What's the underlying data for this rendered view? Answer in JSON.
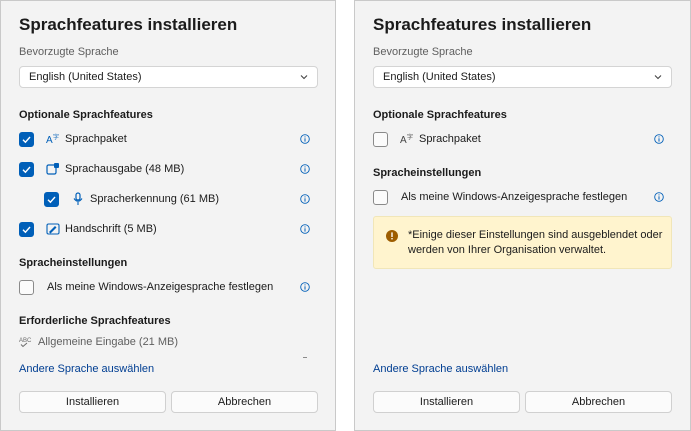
{
  "dialog_a": {
    "title": "Sprachfeatures installieren",
    "preferred_label": "Bevorzugte Sprache",
    "preferred_value": "English (United States)",
    "optional_heading": "Optionale Sprachfeatures",
    "items": [
      {
        "label": "Sprachpaket",
        "checked": true,
        "icon": "language-pack-icon"
      },
      {
        "label": "Sprachausgabe (48 MB)",
        "checked": true,
        "icon": "speech-output-icon"
      },
      {
        "label": "Spracherkennung (61 MB)",
        "checked": true,
        "icon": "microphone-icon"
      },
      {
        "label": "Handschrift (5 MB)",
        "checked": true,
        "icon": "handwriting-icon"
      }
    ],
    "settings_heading": "Spracheinstellungen",
    "windows_display_label": "Als meine Windows-Anzeigesprache festlegen",
    "windows_display_checked": false,
    "required_heading": "Erforderliche Sprachfeatures",
    "required_item": "Allgemeine Eingabe (21 MB)",
    "required_icon": "abc-spellcheck-icon",
    "other_language_link": "Andere Sprache auswählen",
    "install_label": "Installieren",
    "cancel_label": "Abbrechen"
  },
  "dialog_b": {
    "title": "Sprachfeatures installieren",
    "preferred_label": "Bevorzugte Sprache",
    "preferred_value": "English (United States)",
    "optional_heading": "Optionale Sprachfeatures",
    "item_label": "Sprachpaket",
    "item_checked": false,
    "settings_heading": "Spracheinstellungen",
    "windows_display_label": "Als meine Windows-Anzeigesprache festlegen",
    "windows_display_checked": false,
    "warning_text": "*Einige dieser Einstellungen sind ausgeblendet oder werden von Ihrer Organisation verwaltet.",
    "other_language_link": "Andere Sprache auswählen",
    "install_label": "Installieren",
    "cancel_label": "Abbrechen"
  },
  "colors": {
    "accent": "#005fb8",
    "link": "#003e92",
    "info": "#005fb8",
    "warning_bg": "#fff4ce",
    "warning_icon": "#9d5d00"
  }
}
